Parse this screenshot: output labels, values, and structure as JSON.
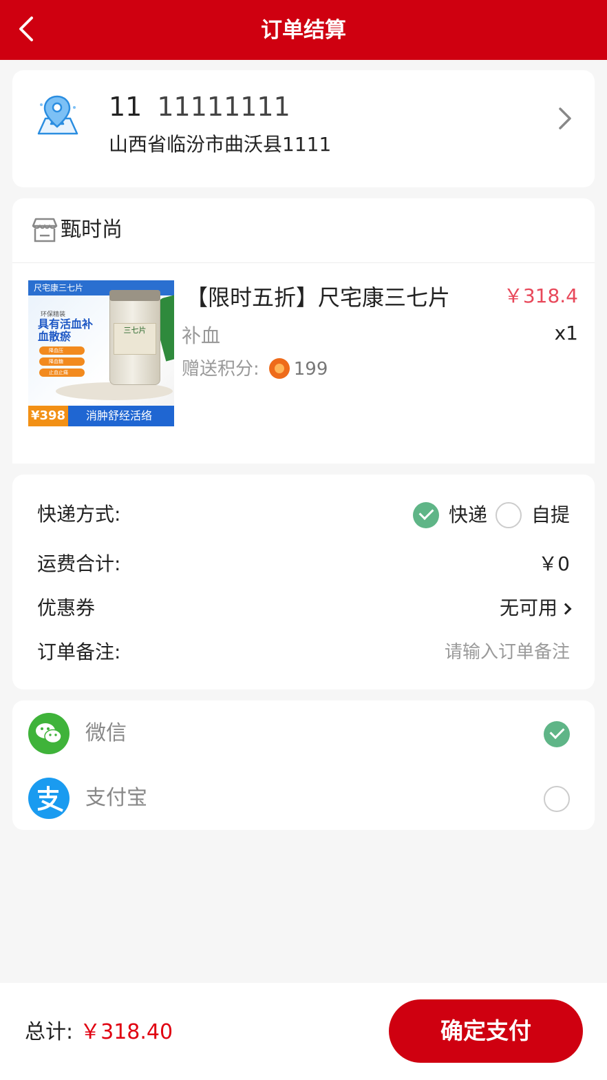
{
  "header": {
    "title": "订单结算"
  },
  "address": {
    "name": "11",
    "phone": "11111111",
    "detail": "山西省临汾市曲沃县1111"
  },
  "store": {
    "name": "甄时尚"
  },
  "product": {
    "title": "【限时五折】尺宅康三七片",
    "price": "￥318.4",
    "spec": "补血",
    "quantity": "x1",
    "points_label": "赠送积分:",
    "points_value": "199",
    "image_texts": {
      "top": "尺宅康三七片",
      "sub": "环保精装",
      "headline": "具有活血补血散瘀",
      "tags": [
        "降血压",
        "降血糖",
        "止血止痛"
      ],
      "jar_label": "三七片",
      "price": "¥398",
      "slogan": "消肿舒经活络"
    }
  },
  "delivery": {
    "method_label": "快递方式:",
    "options": [
      {
        "label": "快递",
        "selected": true
      },
      {
        "label": "自提",
        "selected": false
      }
    ],
    "shipping_label": "运费合计:",
    "shipping_value": "￥0",
    "coupon_label": "优惠券",
    "coupon_value": "无可用",
    "remark_label": "订单备注:",
    "remark_placeholder": "请输入订单备注"
  },
  "payment": {
    "methods": [
      {
        "label": "微信",
        "icon": "wechat-icon",
        "selected": true
      },
      {
        "label": "支付宝",
        "icon": "alipay-icon",
        "selected": false
      }
    ]
  },
  "footer": {
    "total_label": "总计:",
    "total_value": "￥318.40",
    "pay_button": "确定支付"
  },
  "colors": {
    "brand_red": "#cf0010",
    "price_pink": "#e8485a",
    "check_green": "#5fb587",
    "wechat_green": "#3fb33a",
    "alipay_blue": "#1a9bf0"
  }
}
